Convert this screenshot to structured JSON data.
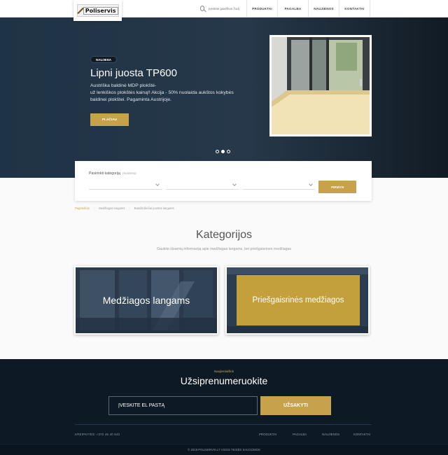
{
  "header": {
    "logo_text": "Poliservis",
    "search_placeholder": "Įveskite paieškos žodį",
    "nav": [
      "PRODUKTAI",
      "PAGALBA",
      "NAUJIENOS",
      "KONTAKTAI"
    ]
  },
  "hero": {
    "badge": "NAUJIENA",
    "title": "Lipni juosta TP600",
    "text": "Austriška baldinė MDP plokštė-\nuž lenkiškos plokštės kainą!! Akcija - 50% nuolaida aukštos kokybės\nbaldinei plokštei. Pagaminta Austrijoje.",
    "button": "PLAČIAU",
    "slides": 3,
    "active_slide": 2
  },
  "filter": {
    "label": "Pasirinkti kategoriją",
    "label_note": "(Nebūtina)",
    "button": "PIRMYN"
  },
  "breadcrumb": [
    "Pagrindinis",
    "Medžiagos langams",
    "Butažiniliečiai juostos langams"
  ],
  "categories": {
    "title": "Kategorijos",
    "subtitle": "Gaukite išsamią informaciją apie medžiagas langams, bei priešgaisrines medžiagas",
    "items": [
      "Medžiagos langams",
      "Priešgaisrinės medžiagos"
    ]
  },
  "subscribe": {
    "eyebrow": "Naujienlaiškis",
    "title": "Užsiprenumeruokite",
    "email_placeholder": "ĮVESKITE EL PAŠTĄ",
    "button": "UŽSAKYTI"
  },
  "footer": {
    "contact": "KREIPKITĖS: +370 46 40 643",
    "nav": [
      "PRODUKTAI",
      "PAGALBA",
      "NAUJIENOS",
      "KONTAKTAI"
    ],
    "copyright": "© 2019 POLISERVIS.LT VISOS TEISĖS SAUGOMOS"
  },
  "colors": {
    "accent": "#c7a24a",
    "hero_dark": "#1f3346",
    "footer_bg": "#0d1a26"
  }
}
